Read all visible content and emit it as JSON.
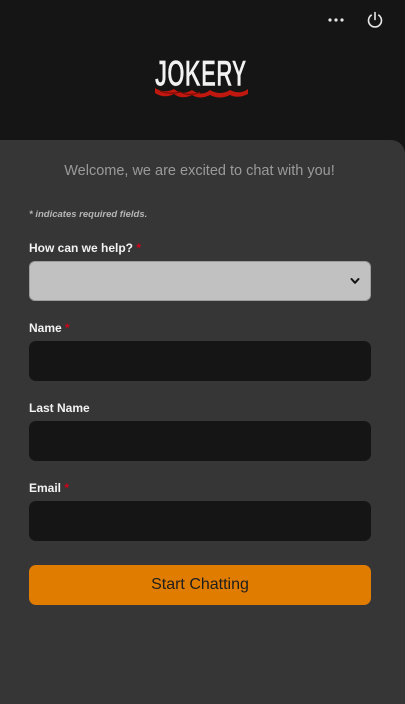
{
  "header": {
    "logo_text": "JOKERY",
    "more_icon": "more-horizontal-icon",
    "power_icon": "power-icon"
  },
  "form": {
    "welcome": "Welcome, we are excited to chat with you!",
    "required_note": "* indicates required fields.",
    "fields": [
      {
        "label": "How can we help?",
        "required": true,
        "type": "select",
        "value": ""
      },
      {
        "label": "Name",
        "required": true,
        "type": "text",
        "value": ""
      },
      {
        "label": "Last Name",
        "required": false,
        "type": "text",
        "value": ""
      },
      {
        "label": "Email",
        "required": true,
        "type": "text",
        "value": ""
      }
    ],
    "required_marker": "*",
    "submit_label": "Start Chatting"
  },
  "colors": {
    "accent": "#e07c00",
    "required": "#d0021b",
    "panel": "#363636",
    "header": "#151515"
  }
}
